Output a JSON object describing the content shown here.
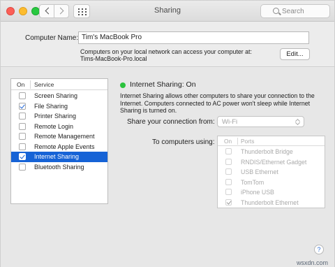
{
  "window": {
    "title": "Sharing"
  },
  "toolbar": {
    "search_placeholder": "Search"
  },
  "computer_name": {
    "label": "Computer Name:",
    "value": "Tim's MacBook Pro",
    "note_line1": "Computers on your local network can access your computer at:",
    "note_line2": "Tims-MacBook-Pro.local",
    "edit_label": "Edit..."
  },
  "services": {
    "col_on": "On",
    "col_service": "Service",
    "items": [
      {
        "label": "Screen Sharing",
        "checked": false,
        "selected": false
      },
      {
        "label": "File Sharing",
        "checked": true,
        "selected": false
      },
      {
        "label": "Printer Sharing",
        "checked": false,
        "selected": false
      },
      {
        "label": "Remote Login",
        "checked": false,
        "selected": false
      },
      {
        "label": "Remote Management",
        "checked": false,
        "selected": false
      },
      {
        "label": "Remote Apple Events",
        "checked": false,
        "selected": false
      },
      {
        "label": "Internet Sharing",
        "checked": true,
        "selected": true
      },
      {
        "label": "Bluetooth Sharing",
        "checked": false,
        "selected": false
      }
    ]
  },
  "detail": {
    "status": "Internet Sharing: On",
    "status_color": "#2bc23d",
    "description_line1": "Internet Sharing allows other computers to share your connection to the",
    "description_line2": "Internet. Computers connected to AC power won't sleep while Internet",
    "description_line3": "Sharing is turned on.",
    "share_from_label": "Share your connection from:",
    "share_from_value": "Wi-Fi",
    "to_computers_label": "To computers using:",
    "ports_col_on": "On",
    "ports_col_ports": "Ports",
    "ports": [
      {
        "label": "Thunderbolt Bridge",
        "checked": false
      },
      {
        "label": "RNDIS/Ethernet Gadget",
        "checked": false
      },
      {
        "label": "USB Ethernet",
        "checked": false
      },
      {
        "label": "TomTom",
        "checked": false
      },
      {
        "label": "iPhone USB",
        "checked": false
      },
      {
        "label": "Thunderbolt Ethernet",
        "checked": true
      }
    ]
  },
  "help_label": "?",
  "watermark": "wsxdn.com"
}
